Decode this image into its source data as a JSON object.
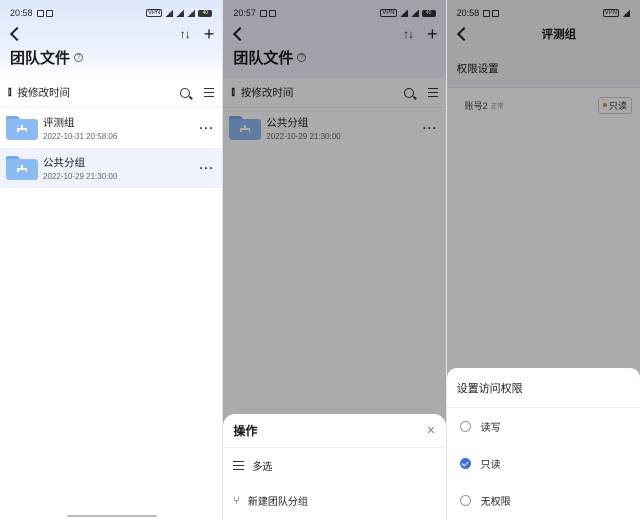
{
  "panel1": {
    "status": {
      "time": "20:58",
      "battery": "40"
    },
    "title": "团队文件",
    "sort_label": "按修改时间",
    "files": [
      {
        "name": "评测组",
        "date": "2022-10-31 20:58:06"
      },
      {
        "name": "公共分组",
        "date": "2022-10-29 21:30:00"
      }
    ]
  },
  "panel2": {
    "status": {
      "time": "20:57",
      "battery": "40"
    },
    "title": "团队文件",
    "sort_label": "按修改时间",
    "files": [
      {
        "name": "公共分组",
        "date": "2022-10-29 21:30:00"
      }
    ],
    "sheet": {
      "title": "操作",
      "items": [
        "多选",
        "新建团队分组"
      ]
    }
  },
  "panel3": {
    "status": {
      "time": "20:58"
    },
    "title": "评测组",
    "section": "权限设置",
    "account": {
      "name": "账号2",
      "state": "正常",
      "perm": "只读"
    },
    "sheet": {
      "title": "设置访问权限",
      "options": [
        "读写",
        "只读",
        "无权限"
      ],
      "selected": 1
    }
  },
  "colors": {
    "accent": "#3b6fe3",
    "folder": "#8cbaf2",
    "header": "#dfe8fb"
  }
}
